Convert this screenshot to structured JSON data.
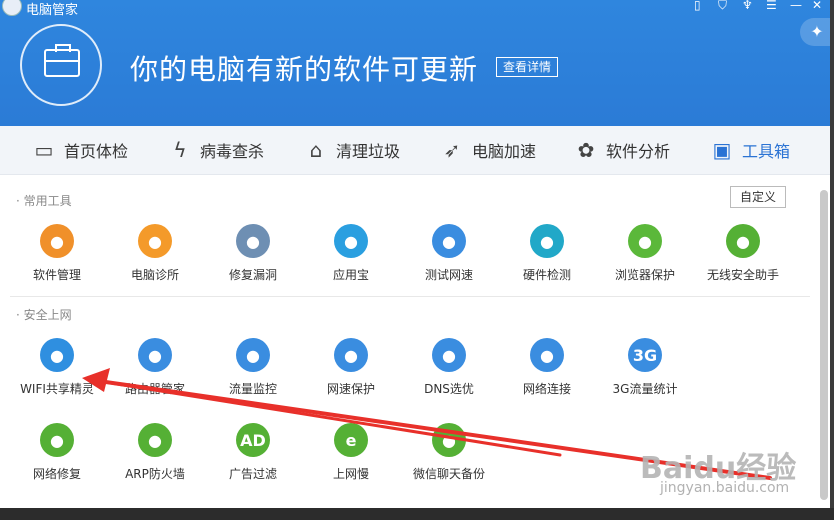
{
  "window": {
    "title": "电脑管家"
  },
  "hero": {
    "message": "你的电脑有新的软件可更新",
    "detail_label": "查看详情"
  },
  "tabs": [
    {
      "label": "首页体检",
      "icon": "monitor-icon"
    },
    {
      "label": "病毒查杀",
      "icon": "lightning-icon"
    },
    {
      "label": "清理垃圾",
      "icon": "broom-icon"
    },
    {
      "label": "电脑加速",
      "icon": "rocket-icon"
    },
    {
      "label": "软件分析",
      "icon": "fan-icon"
    },
    {
      "label": "工具箱",
      "icon": "toolbox-icon",
      "active": true
    }
  ],
  "sections": {
    "common": {
      "title": "· 常用工具",
      "customize_label": "自定义",
      "tools": [
        {
          "label": "软件管理",
          "icon": "clover-icon",
          "color": "#f0902a"
        },
        {
          "label": "电脑诊所",
          "icon": "stethoscope-icon",
          "color": "#f49a2a"
        },
        {
          "label": "修复漏洞",
          "icon": "repair-icon",
          "color": "#6e8fb3"
        },
        {
          "label": "应用宝",
          "icon": "appstore-icon",
          "color": "#2a9fe0"
        },
        {
          "label": "测试网速",
          "icon": "speedometer-icon",
          "color": "#3a8de0"
        },
        {
          "label": "硬件检测",
          "icon": "chip-icon",
          "color": "#21a8c8"
        },
        {
          "label": "浏览器保护",
          "icon": "browser-shield-icon",
          "color": "#5bb83a"
        },
        {
          "label": "无线安全助手",
          "icon": "wifi-shield-icon",
          "color": "#55b035"
        }
      ]
    },
    "secure": {
      "title": "· 安全上网",
      "tools": [
        {
          "label": "WIFI共享精灵",
          "icon": "wifi-share-icon",
          "color": "#2f8fe0"
        },
        {
          "label": "路由器管家",
          "icon": "router-icon",
          "color": "#3a8de0"
        },
        {
          "label": "流量监控",
          "icon": "traffic-icon",
          "color": "#3a8de0"
        },
        {
          "label": "网速保护",
          "icon": "speed-shield-icon",
          "color": "#3a8de0"
        },
        {
          "label": "DNS选优",
          "icon": "dns-icon",
          "color": "#3a8de0"
        },
        {
          "label": "网络连接",
          "icon": "globe-icon",
          "color": "#3a8de0"
        },
        {
          "label": "3G流量统计",
          "icon": "3g-icon",
          "color": "#3a8de0",
          "glyph": "3G"
        }
      ]
    },
    "secure2": {
      "tools": [
        {
          "label": "网络修复",
          "icon": "wrench-icon",
          "color": "#55b035"
        },
        {
          "label": "ARP防火墙",
          "icon": "firewall-icon",
          "color": "#55b035"
        },
        {
          "label": "广告过滤",
          "icon": "ad-filter-icon",
          "color": "#55b035",
          "glyph": "AD"
        },
        {
          "label": "上网慢",
          "icon": "ie-icon",
          "color": "#55b035",
          "glyph": "e"
        },
        {
          "label": "微信聊天备份",
          "icon": "wechat-icon",
          "color": "#55b035"
        }
      ]
    }
  },
  "watermark": {
    "brand": "Baidu经验",
    "url": "jingyan.baidu.com"
  }
}
